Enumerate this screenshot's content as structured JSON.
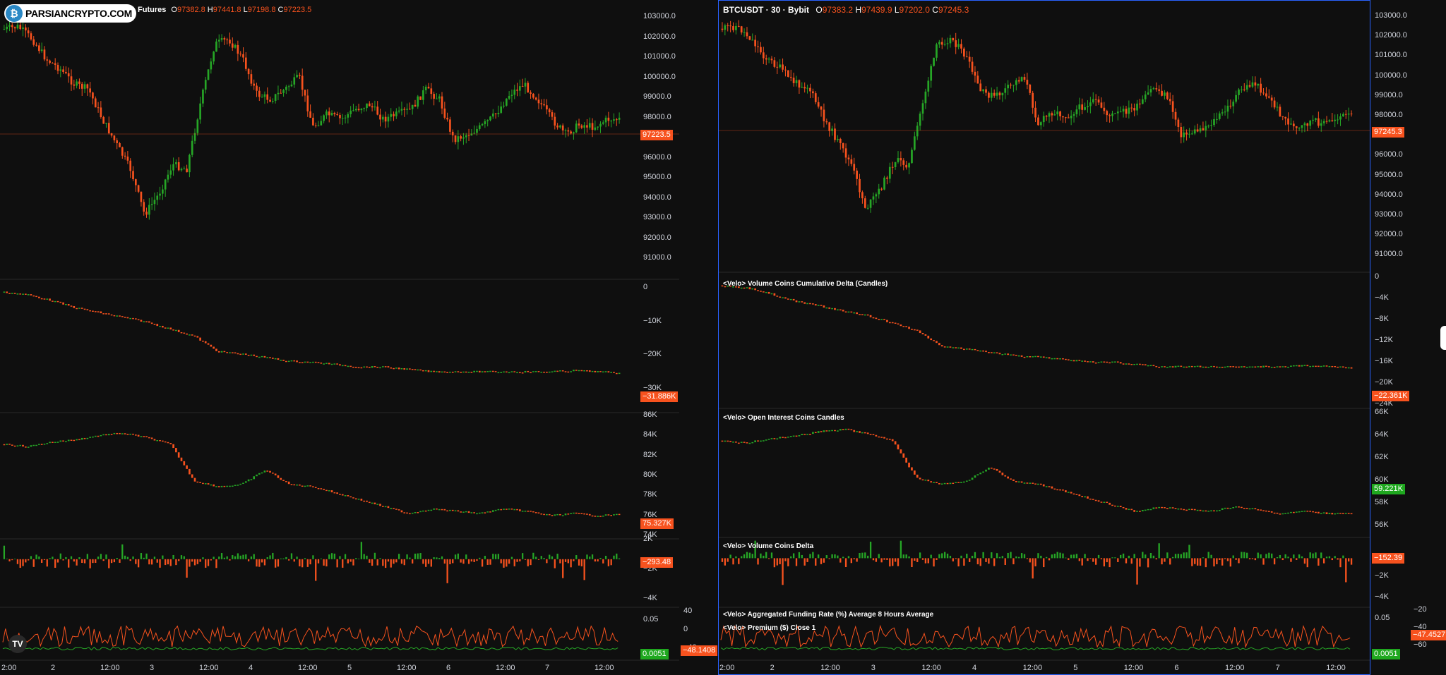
{
  "branding": {
    "logo_text": "PARSIANCRYPTO.COM",
    "tv_glyph": "TV"
  },
  "left_chart": {
    "legend_partial": "Futures",
    "ohlc": {
      "o_label": "O",
      "o": "97382.8",
      "h_label": "H",
      "h": "97441.8",
      "l_label": "L",
      "l": "97198.8",
      "c_label": "C",
      "c": "97223.5"
    },
    "price_axis": [
      "103000.0",
      "102000.0",
      "101000.0",
      "100000.0",
      "99000.0",
      "98000.0",
      "97000.0",
      "96000.0",
      "95000.0",
      "94000.0",
      "93000.0",
      "92000.0",
      "91000.0"
    ],
    "price_tag": "97223.5",
    "cvd_axis": [
      "0",
      "−10K",
      "−20K",
      "−30K"
    ],
    "cvd_tag": "−31.886K",
    "oi_axis": [
      "86K",
      "84K",
      "82K",
      "80K",
      "78K",
      "76K",
      "74K"
    ],
    "oi_tag": "75.327K",
    "delta_axis": [
      "2K",
      "−2K",
      "−4K"
    ],
    "delta_tag": "−293.48",
    "funding_axis": [
      "0.05"
    ],
    "funding_tag": "0.0051",
    "premium_axis": [
      "40",
      "0",
      "−40"
    ],
    "premium_tag": "−48.1408",
    "time_axis": [
      "2:00",
      "2",
      "12:00",
      "3",
      "12:00",
      "4",
      "12:00",
      "5",
      "12:00",
      "6",
      "12:00",
      "7",
      "12:00"
    ]
  },
  "right_chart": {
    "symbol": "BTCUSDT · 30 · Bybit",
    "ohlc": {
      "o_label": "O",
      "o": "97383.2",
      "h_label": "H",
      "h": "97439.9",
      "l_label": "L",
      "l": "97202.0",
      "c_label": "C",
      "c": "97245.3"
    },
    "price_axis": [
      "103000.0",
      "102000.0",
      "101000.0",
      "100000.0",
      "99000.0",
      "98000.0",
      "97000.0",
      "96000.0",
      "95000.0",
      "94000.0",
      "93000.0",
      "92000.0",
      "91000.0"
    ],
    "price_tag": "97245.3",
    "cvd_title": "<Velo> Volume Coins Cumulative Delta (Candles)",
    "cvd_axis": [
      "0",
      "−4K",
      "−8K",
      "−12K",
      "−16K",
      "−20K",
      "−24K"
    ],
    "cvd_tag": "−22.361K",
    "oi_title": "<Velo> Open Interest Coins Candles",
    "oi_axis": [
      "66K",
      "64K",
      "62K",
      "60K",
      "58K",
      "56K"
    ],
    "oi_tag": "59.221K",
    "delta_title": "<Velo> Volume Coins Delta",
    "delta_axis": [
      "−2K",
      "−4K"
    ],
    "delta_tag": "−152.39",
    "funding_title": "<Velo> Aggregated Funding Rate (%) Average 8 Hours Average",
    "premium_title": "<Velo> Premium ($) Close 1",
    "funding_axis": [
      "0.05"
    ],
    "funding_tag": "0.0051",
    "premium_axis": [
      "−20",
      "−40",
      "−60"
    ],
    "premium_tag": "−47.4527",
    "time_axis": [
      "2:00",
      "2",
      "12:00",
      "3",
      "12:00",
      "4",
      "12:00",
      "5",
      "12:00",
      "6",
      "12:00",
      "7",
      "12:00"
    ]
  },
  "colors": {
    "up": "#26a626",
    "down": "#f7521e",
    "bg": "#0f0f0f",
    "grid": "#2a2a2a",
    "active": "#2962ff"
  }
}
